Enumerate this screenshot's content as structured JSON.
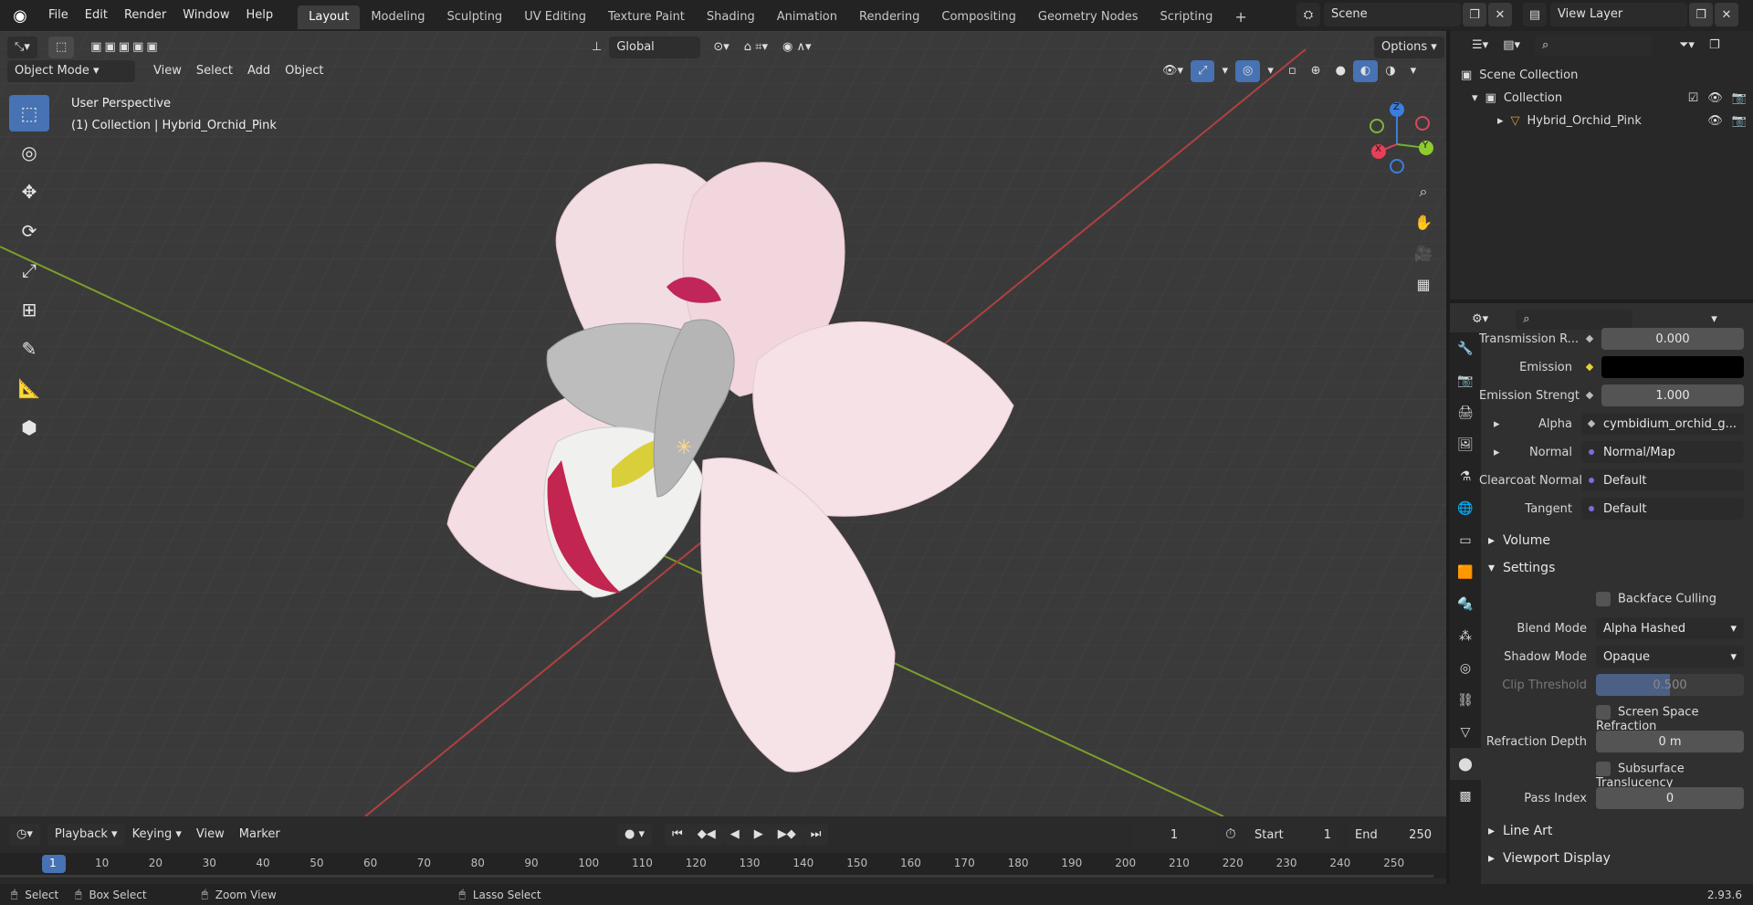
{
  "menu": [
    "File",
    "Edit",
    "Render",
    "Window",
    "Help"
  ],
  "workspaces": [
    "Layout",
    "Modeling",
    "Sculpting",
    "UV Editing",
    "Texture Paint",
    "Shading",
    "Animation",
    "Rendering",
    "Compositing",
    "Geometry Nodes",
    "Scripting"
  ],
  "active_workspace": "Layout",
  "scene": "Scene",
  "view_layer": "View Layer",
  "viewport": {
    "mode": "Object Mode",
    "menus": [
      "View",
      "Select",
      "Add",
      "Object"
    ],
    "transform_orientation": "Global",
    "options": "Options",
    "overlay_title": "User Perspective",
    "overlay_subtitle": "(1) Collection | Hybrid_Orchid_Pink",
    "gizmo": {
      "z": "Z",
      "y": "Y",
      "x": "X"
    }
  },
  "outliner": {
    "root": "Scene Collection",
    "collection": "Collection",
    "object": "Hybrid_Orchid_Pink"
  },
  "properties": {
    "rows": [
      {
        "label": "Transmission R...",
        "value": "0.000",
        "socket": "grey",
        "style": "bar"
      },
      {
        "label": "Emission",
        "value": "",
        "socket": "yellow",
        "style": "black"
      },
      {
        "label": "Emission Strengt",
        "value": "1.000",
        "socket": "grey",
        "style": "bar"
      },
      {
        "label": "Alpha",
        "value": "cymbidium_orchid_g...",
        "socket": "grey",
        "style": "dark",
        "expand": true
      },
      {
        "label": "Normal",
        "value": "Normal/Map",
        "socket": "purple",
        "style": "dark",
        "expand": true
      },
      {
        "label": "Clearcoat Normal",
        "value": "Default",
        "socket": "purple",
        "style": "dark"
      },
      {
        "label": "Tangent",
        "value": "Default",
        "socket": "purple",
        "style": "dark"
      }
    ],
    "volume": "Volume",
    "settings": "Settings",
    "backface_culling": "Backface Culling",
    "blend_mode_label": "Blend Mode",
    "blend_mode": "Alpha Hashed",
    "shadow_mode_label": "Shadow Mode",
    "shadow_mode": "Opaque",
    "clip_threshold_label": "Clip Threshold",
    "clip_threshold": "0.500",
    "ssr": "Screen Space Refraction",
    "refraction_depth_label": "Refraction Depth",
    "refraction_depth": "0 m",
    "subsurface": "Subsurface Translucency",
    "pass_index_label": "Pass Index",
    "pass_index": "0",
    "line_art": "Line Art",
    "viewport_display": "Viewport Display"
  },
  "timeline": {
    "menus": [
      "Playback",
      "Keying",
      "View",
      "Marker"
    ],
    "current_frame": "1",
    "start_label": "Start",
    "start": "1",
    "end_label": "End",
    "end": "250",
    "ticks": [
      "1",
      "10",
      "20",
      "30",
      "40",
      "50",
      "60",
      "70",
      "80",
      "90",
      "100",
      "110",
      "120",
      "130",
      "140",
      "150",
      "160",
      "170",
      "180",
      "190",
      "200",
      "210",
      "220",
      "230",
      "240",
      "250"
    ]
  },
  "status": {
    "select": "Select",
    "box_select": "Box Select",
    "zoom_view": "Zoom View",
    "lasso_select": "Lasso Select",
    "version": "2.93.6"
  }
}
